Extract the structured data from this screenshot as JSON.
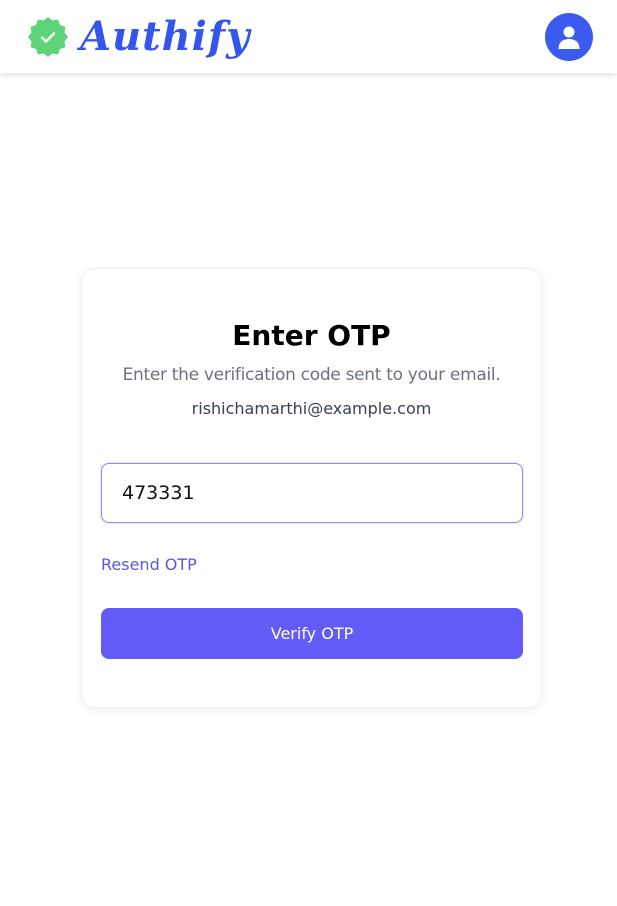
{
  "header": {
    "brand_name": "Authify",
    "brand_icon": "verified-badge-icon",
    "profile_icon": "user-icon"
  },
  "form": {
    "title": "Enter OTP",
    "subtitle": "Enter the verification code sent to your email.",
    "email": "rishichamarthi@example.com",
    "otp_value": "473331",
    "resend_label": "Resend OTP",
    "verify_label": "Verify OTP"
  },
  "colors": {
    "brand": "#3355ee",
    "badge": "#5ed47a",
    "primary_button": "#635bf7",
    "link": "#5b5bd6",
    "avatar": "#3b5bf0"
  }
}
